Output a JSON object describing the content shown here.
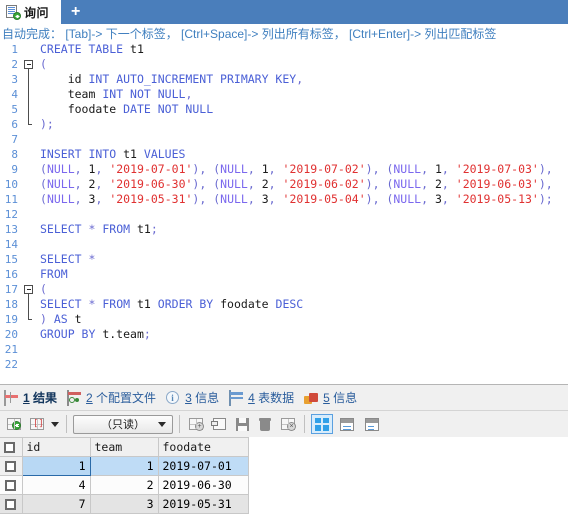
{
  "tabstrip": {
    "tabs": [
      {
        "label": "询问",
        "icon": "document-add-icon",
        "active": true
      }
    ],
    "add_label": "+"
  },
  "hint": {
    "text": "自动完成： [Tab]-> 下一个标签， [Ctrl+Space]-> 列出所有标签， [Ctrl+Enter]-> 列出匹配标签"
  },
  "editor": {
    "lines": [
      {
        "n": "1",
        "fold": "none",
        "html": "<span class=\"kw\">CREATE TABLE</span> <span class=\"id\">t1</span>"
      },
      {
        "n": "2",
        "fold": "box",
        "html": "<span class=\"kw2\">(</span>"
      },
      {
        "n": "3",
        "fold": "line",
        "html": "    <span class=\"id\">id</span> <span class=\"kw\">INT AUTO_INCREMENT PRIMARY KEY</span><span class=\"kw2\">,</span>"
      },
      {
        "n": "4",
        "fold": "line",
        "html": "    <span class=\"id\">team</span> <span class=\"kw\">INT NOT NULL</span><span class=\"kw2\">,</span>"
      },
      {
        "n": "5",
        "fold": "line",
        "html": "    <span class=\"id\">foodate</span> <span class=\"kw\">DATE NOT NULL</span>"
      },
      {
        "n": "6",
        "fold": "end",
        "html": "<span class=\"kw2\">);</span>"
      },
      {
        "n": "7",
        "fold": "none",
        "html": ""
      },
      {
        "n": "8",
        "fold": "none",
        "html": "<span class=\"kw\">INSERT INTO</span> <span class=\"id\">t1</span> <span class=\"kw\">VALUES</span>"
      },
      {
        "n": "9",
        "fold": "none",
        "html": "<span class=\"kw2\">(</span><span class=\"nul\">NULL</span><span class=\"kw2\">,</span> <span class=\"num\">1</span><span class=\"kw2\">,</span> <span class=\"str\">'2019-07-01'</span><span class=\"kw2\">),</span> <span class=\"kw2\">(</span><span class=\"nul\">NULL</span><span class=\"kw2\">,</span> <span class=\"num\">1</span><span class=\"kw2\">,</span> <span class=\"str\">'2019-07-02'</span><span class=\"kw2\">),</span> <span class=\"kw2\">(</span><span class=\"nul\">NULL</span><span class=\"kw2\">,</span> <span class=\"num\">1</span><span class=\"kw2\">,</span> <span class=\"str\">'2019-07-03'</span><span class=\"kw2\">),</span>"
      },
      {
        "n": "10",
        "fold": "none",
        "html": "<span class=\"kw2\">(</span><span class=\"nul\">NULL</span><span class=\"kw2\">,</span> <span class=\"num\">2</span><span class=\"kw2\">,</span> <span class=\"str\">'2019-06-30'</span><span class=\"kw2\">),</span> <span class=\"kw2\">(</span><span class=\"nul\">NULL</span><span class=\"kw2\">,</span> <span class=\"num\">2</span><span class=\"kw2\">,</span> <span class=\"str\">'2019-06-02'</span><span class=\"kw2\">),</span> <span class=\"kw2\">(</span><span class=\"nul\">NULL</span><span class=\"kw2\">,</span> <span class=\"num\">2</span><span class=\"kw2\">,</span> <span class=\"str\">'2019-06-03'</span><span class=\"kw2\">),</span>"
      },
      {
        "n": "11",
        "fold": "none",
        "html": "<span class=\"kw2\">(</span><span class=\"nul\">NULL</span><span class=\"kw2\">,</span> <span class=\"num\">3</span><span class=\"kw2\">,</span> <span class=\"str\">'2019-05-31'</span><span class=\"kw2\">),</span> <span class=\"kw2\">(</span><span class=\"nul\">NULL</span><span class=\"kw2\">,</span> <span class=\"num\">3</span><span class=\"kw2\">,</span> <span class=\"str\">'2019-05-04'</span><span class=\"kw2\">),</span> <span class=\"kw2\">(</span><span class=\"nul\">NULL</span><span class=\"kw2\">,</span> <span class=\"num\">3</span><span class=\"kw2\">,</span> <span class=\"str\">'2019-05-13'</span><span class=\"kw2\">);</span>"
      },
      {
        "n": "12",
        "fold": "none",
        "html": ""
      },
      {
        "n": "13",
        "fold": "none",
        "html": "<span class=\"kw\">SELECT</span> <span class=\"kw2\">*</span> <span class=\"kw\">FROM</span> <span class=\"id\">t1</span><span class=\"kw2\">;</span>"
      },
      {
        "n": "14",
        "fold": "none",
        "html": ""
      },
      {
        "n": "15",
        "fold": "none",
        "html": "<span class=\"kw\">SELECT</span> <span class=\"kw2\">*</span>"
      },
      {
        "n": "16",
        "fold": "none",
        "html": "<span class=\"kw\">FROM</span>"
      },
      {
        "n": "17",
        "fold": "box",
        "html": "<span class=\"kw2\">(</span>"
      },
      {
        "n": "18",
        "fold": "line",
        "html": "<span class=\"kw\">SELECT</span> <span class=\"kw2\">*</span> <span class=\"kw\">FROM</span> <span class=\"id\">t1</span> <span class=\"kw\">ORDER BY</span> <span class=\"id\">foodate</span> <span class=\"kw\">DESC</span>"
      },
      {
        "n": "19",
        "fold": "end",
        "html": "<span class=\"kw2\">)</span> <span class=\"kw\">AS</span> <span class=\"id\">t</span>"
      },
      {
        "n": "20",
        "fold": "none",
        "html": "<span class=\"kw\">GROUP BY</span> <span class=\"id\">t.team</span><span class=\"kw2\">;</span>"
      },
      {
        "n": "21",
        "fold": "none",
        "html": ""
      },
      {
        "n": "22",
        "fold": "none",
        "html": ""
      }
    ]
  },
  "result_tabs": [
    {
      "num": "1",
      "label": "结果",
      "icon": "result-grid-icon",
      "active": true
    },
    {
      "num": "2",
      "label": "个配置文件",
      "icon": "profile-icon",
      "active": false
    },
    {
      "num": "3",
      "label": "信息",
      "icon": "info-circle-icon",
      "active": false
    },
    {
      "num": "4",
      "label": "表数据",
      "icon": "table-data-icon",
      "active": false
    },
    {
      "num": "5",
      "label": "信息",
      "icon": "chart-icon",
      "active": false
    }
  ],
  "toolbar": {
    "buttons": [
      {
        "name": "add-record-button",
        "icon": "grid-add-icon"
      },
      {
        "name": "record-filter-button",
        "icon": "grid-brackets-icon"
      }
    ],
    "mode_value": "（只读）",
    "actions": [
      {
        "name": "insert-record-button",
        "icon": "grid-plus-icon"
      },
      {
        "name": "duplicate-record-button",
        "icon": "copy-record-icon"
      },
      {
        "name": "save-record-button",
        "icon": "save-icon"
      },
      {
        "name": "delete-record-button",
        "icon": "trash-icon"
      },
      {
        "name": "cancel-edit-button",
        "icon": "grid-cancel-icon"
      }
    ],
    "views": [
      {
        "name": "grid-view-button",
        "icon": "quad-grid-icon",
        "selected": true
      },
      {
        "name": "form-view-button",
        "icon": "split-form-icon",
        "selected": false
      },
      {
        "name": "text-view-button",
        "icon": "text-lines-icon",
        "selected": false
      }
    ]
  },
  "grid": {
    "columns": [
      "id",
      "team",
      "foodate"
    ],
    "rows": [
      {
        "id": "1",
        "team": "1",
        "foodate": "2019-07-01",
        "state": "selected"
      },
      {
        "id": "4",
        "team": "2",
        "foodate": "2019-06-30",
        "state": "odd"
      },
      {
        "id": "7",
        "team": "3",
        "foodate": "2019-05-31",
        "state": "even"
      }
    ]
  }
}
